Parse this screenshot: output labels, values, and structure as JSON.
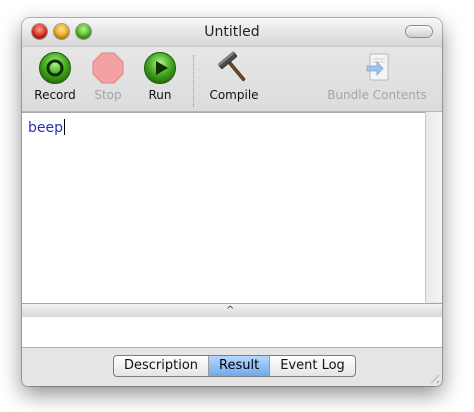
{
  "window": {
    "title": "Untitled"
  },
  "toolbar": {
    "record_label": "Record",
    "stop_label": "Stop",
    "run_label": "Run",
    "compile_label": "Compile",
    "bundle_label": "Bundle Contents",
    "stop_enabled": false,
    "bundle_enabled": false
  },
  "editor": {
    "content": "beep"
  },
  "splitter": {
    "glyph": "^"
  },
  "tabs": {
    "items": [
      "Description",
      "Result",
      "Event Log"
    ],
    "selected": "Result"
  },
  "colors": {
    "record": "#3fa62a",
    "stop": "#e88a8a",
    "run": "#3fa62a",
    "script_text": "#2a2fb0",
    "selected_tab": "#8dbdf5"
  }
}
